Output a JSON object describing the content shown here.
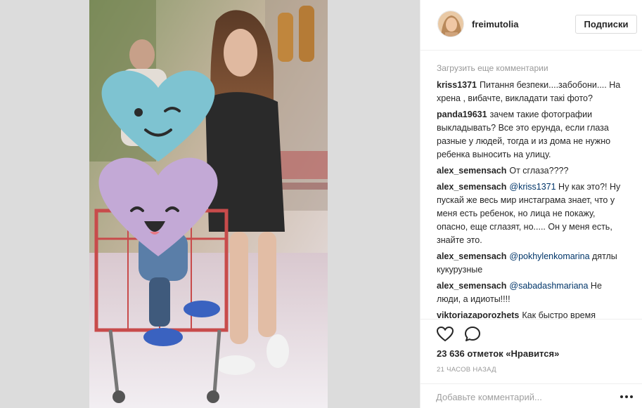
{
  "post": {
    "username": "freimutolia",
    "follow_label": "Подписки",
    "photo_alt": "",
    "load_more": "Загрузить еще комментарии",
    "comments": [
      {
        "user": "kriss1371",
        "parts": [
          {
            "t": "Питання безпеки....забобони.... На хрена , вибачте, викладати такі фото?"
          }
        ]
      },
      {
        "user": "panda19631",
        "parts": [
          {
            "t": "зачем такие фотографии выкладывать? Все это ерунда, если глаза разные у людей, тогда и из дома не нужно ребенка выносить на улицу."
          }
        ]
      },
      {
        "user": "alex_semensach",
        "parts": [
          {
            "t": "От сглаза????"
          }
        ]
      },
      {
        "user": "alex_semensach",
        "parts": [
          {
            "t": "@kriss1371",
            "mention": true
          },
          {
            "t": " Ну как это?! Ну пускай же весь мир инстаграма знает, что у меня есть ребенок, но лица не покажу, опасно, еще сглазят, но..... Он у меня есть, знайте это."
          }
        ]
      },
      {
        "user": "alex_semensach",
        "parts": [
          {
            "t": "@pokhylenkomarina",
            "mention": true
          },
          {
            "t": " дятлы кукурузные"
          }
        ]
      },
      {
        "user": "alex_semensach",
        "parts": [
          {
            "t": "@sabadashmariana",
            "mention": true
          },
          {
            "t": " Не люди, а идиоты!!!!"
          }
        ]
      },
      {
        "user": "viktoriazaporozhets",
        "parts": [
          {
            "t": "Как быстро время"
          }
        ]
      }
    ],
    "likes": "23 636 отметок «Нравится»",
    "time": "21 ЧАСОВ НАЗАД",
    "add_comment_placeholder": "Добавьте комментарий..."
  }
}
